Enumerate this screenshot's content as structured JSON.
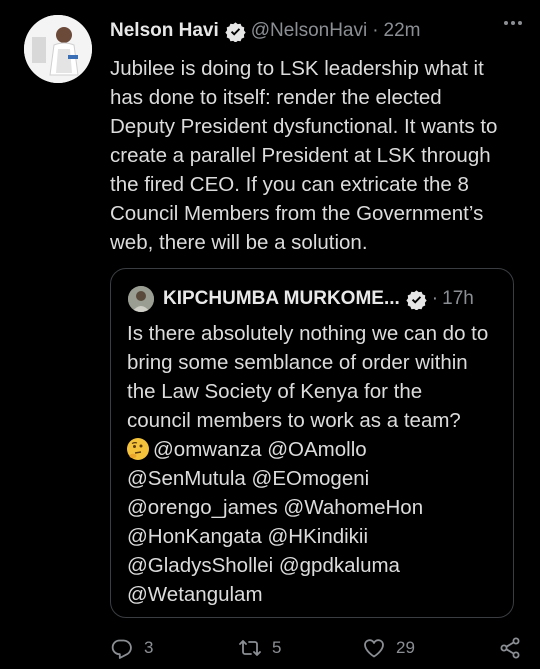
{
  "tweet": {
    "author_name": "Nelson Havi",
    "author_handle": "@NelsonHavi",
    "separator": "·",
    "time": "22m",
    "text_lines": [
      "Jubilee is doing to LSK leadership what it",
      "has done to itself: render the elected",
      "Deputy President dysfunctional. It wants to",
      "create a parallel President at LSK through",
      "the fired CEO. If you can extricate the 8",
      "Council Members from the Government’s",
      "web, there will be a solution."
    ]
  },
  "quoted": {
    "author_name": "KIPCHUMBA MURKOME...",
    "separator": "·",
    "time": "17h",
    "text_lines": [
      "Is there absolutely nothing we can do to",
      "bring some semblance of order within",
      "the Law Society of Kenya for the",
      "council members to work as a team?",
      "@omwanza @OAmollo",
      "@SenMutula @EOmogeni",
      "@orengo_james @WahomeHon",
      "@HonKangata @HKindikii",
      "@GladysShollei @gpdkaluma",
      "@Wetangulam"
    ]
  },
  "actions": {
    "reply_count": "3",
    "retweet_count": "5",
    "like_count": "29"
  },
  "colors": {
    "background": "#000000",
    "text": "#dcdcdc",
    "muted": "#8b8f94",
    "border": "#3a3d41"
  },
  "icons": [
    "verified-badge-icon",
    "more-icon",
    "thinking-face-emoji",
    "reply-icon",
    "retweet-icon",
    "like-icon",
    "share-icon"
  ]
}
